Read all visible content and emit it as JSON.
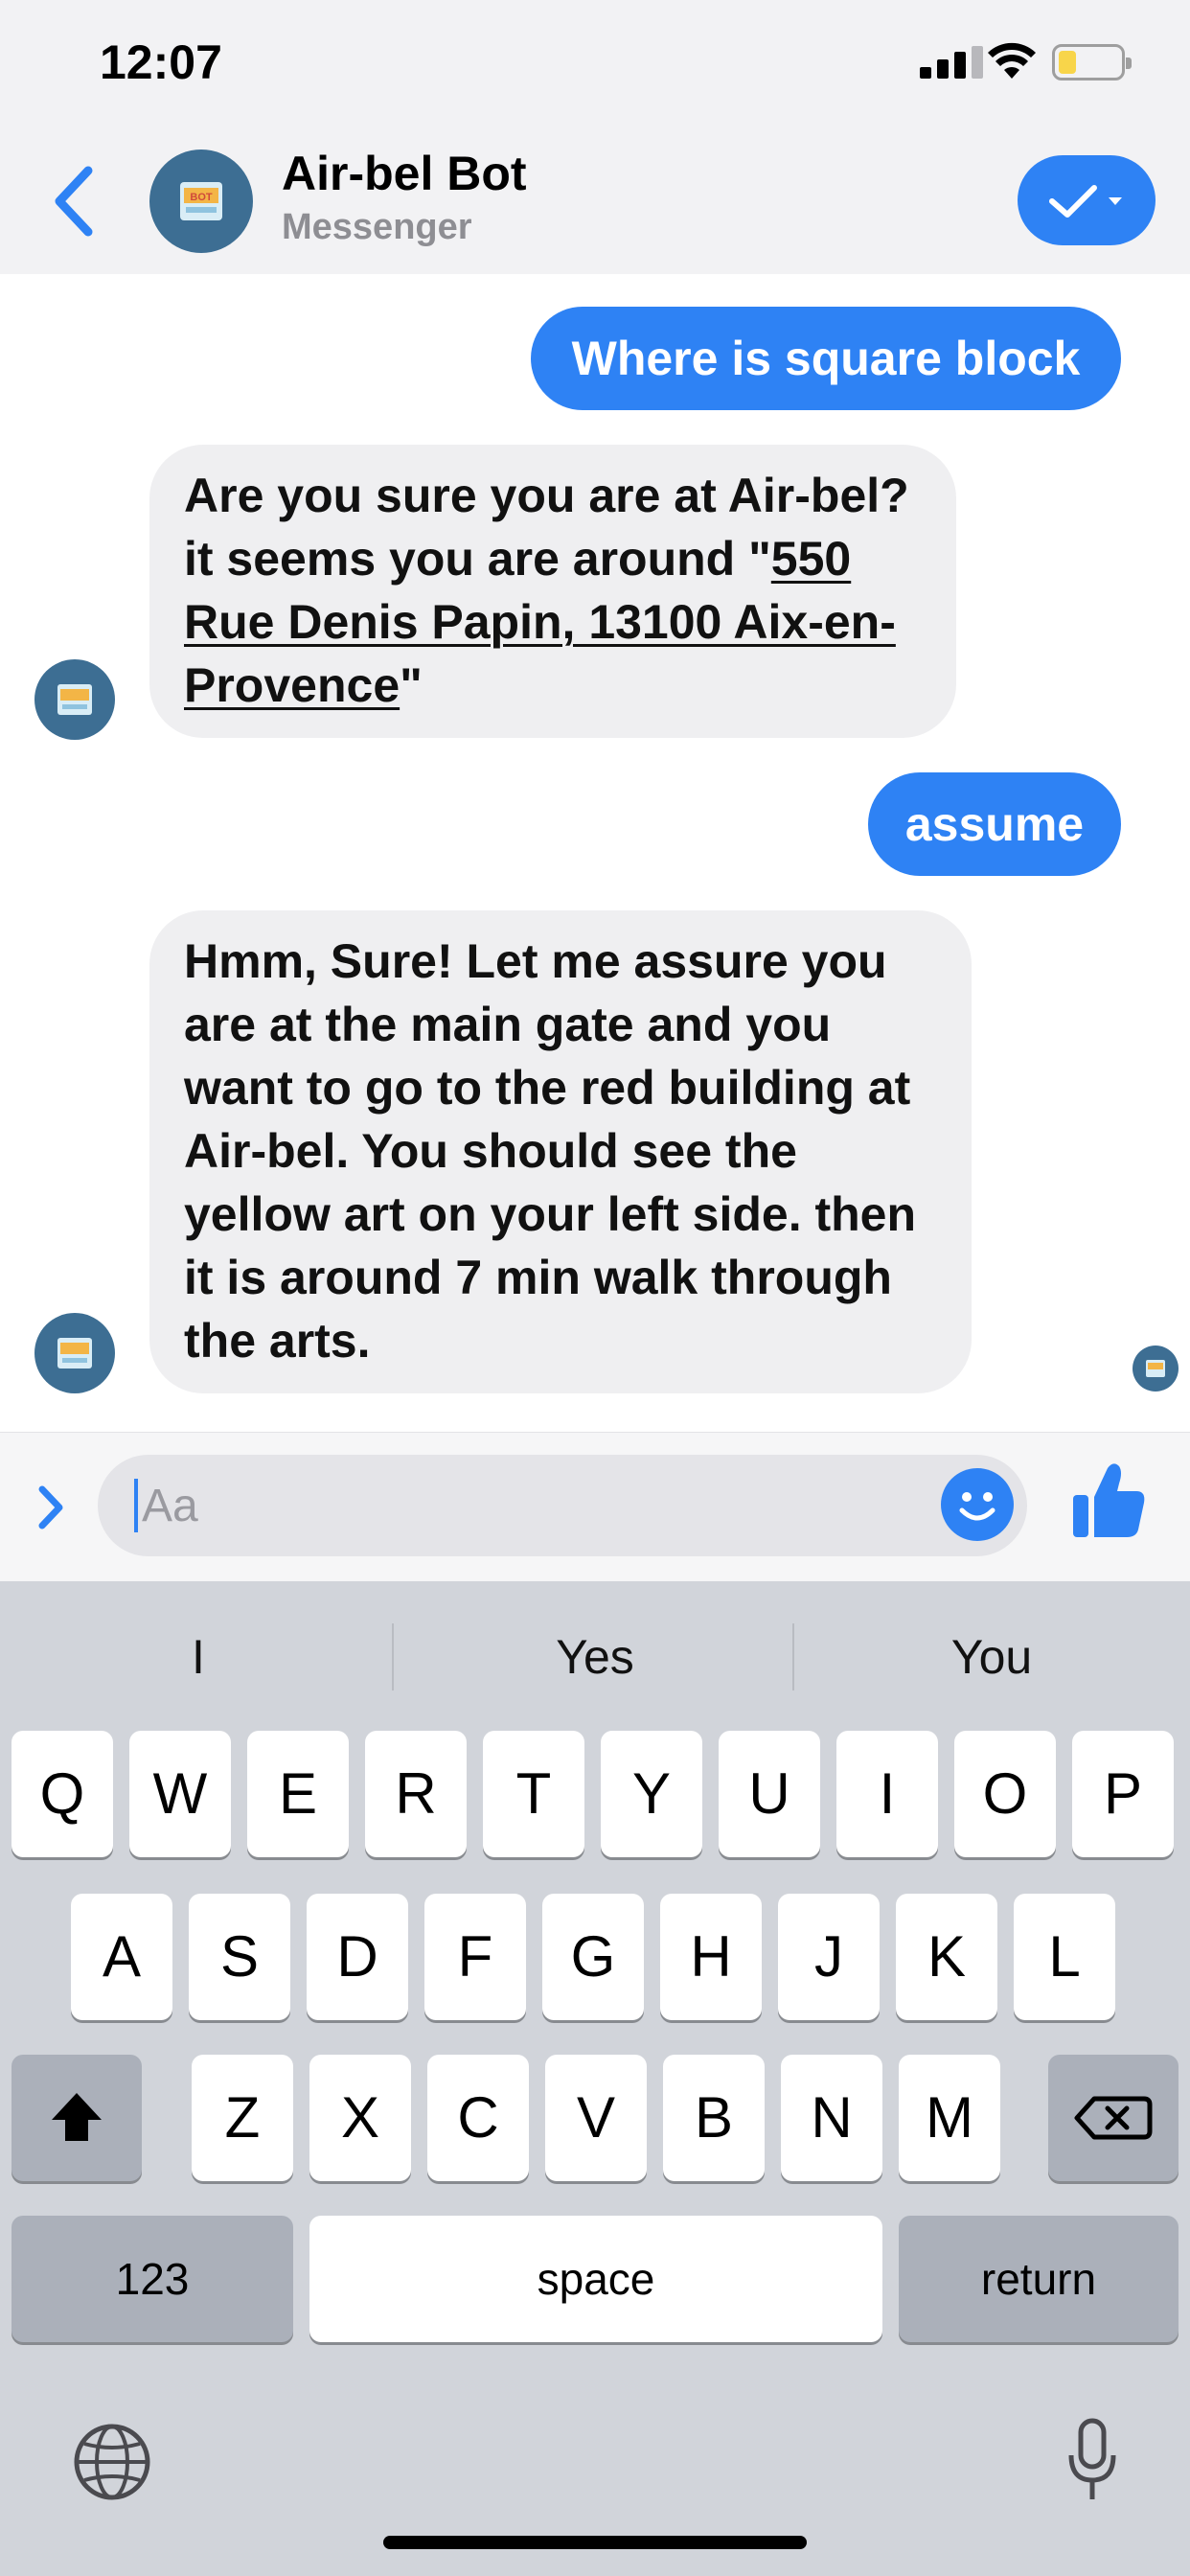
{
  "status_bar": {
    "time": "12:07"
  },
  "header": {
    "bot_name": "Air-bel Bot",
    "subtitle": "Messenger",
    "avatar_label": "BOT"
  },
  "messages": [
    {
      "direction": "out",
      "text": "Where is square block"
    },
    {
      "direction": "in",
      "text_before_link": "Are you sure you are at Air-bel? it seems you are around \"",
      "link_text": "550 Rue Denis Papin, 13100 Aix-en-Provence",
      "text_after_link": "\""
    },
    {
      "direction": "out",
      "text": "assume"
    },
    {
      "direction": "in",
      "text": "Hmm, Sure! Let me assure you are at the main gate and you want to go to the red building at Air-bel. You should see the yellow art on your left side. then it is around 7 min walk through the arts."
    }
  ],
  "composer": {
    "placeholder": "Aa"
  },
  "keyboard": {
    "suggestions": [
      "I",
      "Yes",
      "You"
    ],
    "row1": [
      "Q",
      "W",
      "E",
      "R",
      "T",
      "Y",
      "U",
      "I",
      "O",
      "P"
    ],
    "row2": [
      "A",
      "S",
      "D",
      "F",
      "G",
      "H",
      "J",
      "K",
      "L"
    ],
    "row3": [
      "Z",
      "X",
      "C",
      "V",
      "B",
      "N",
      "M"
    ],
    "numbers_key": "123",
    "space_key": "space",
    "return_key": "return"
  },
  "colors": {
    "accent": "#2e82f4",
    "incoming_bubble": "#efeff1",
    "avatar": "#3d6e93",
    "keyboard_bg": "#d1d4da"
  },
  "icons": [
    "back-chevron-icon",
    "checkmark-icon",
    "expand-chevron-icon",
    "emoji-icon",
    "thumbs-up-icon",
    "shift-icon",
    "backspace-icon",
    "globe-icon",
    "microphone-icon"
  ]
}
